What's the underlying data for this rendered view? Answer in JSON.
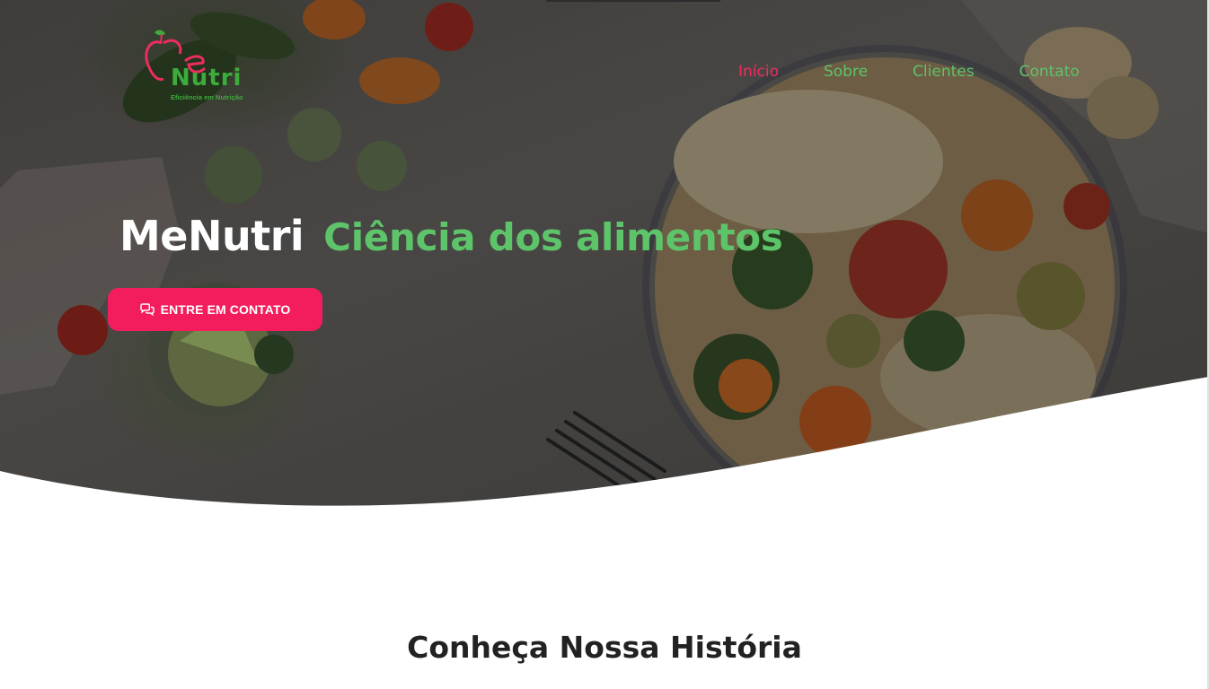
{
  "header": {
    "logo": {
      "brand": "Nutri",
      "tagline": "Eficiência em Nutrição",
      "colors": {
        "primary": "#ef2c60",
        "secondary": "#3dab3d"
      }
    },
    "nav": [
      {
        "label": "Início",
        "active": true
      },
      {
        "label": "Sobre",
        "active": false
      },
      {
        "label": "Clientes",
        "active": false
      },
      {
        "label": "Contato",
        "active": false
      }
    ]
  },
  "hero": {
    "title_brand": "MeNutri",
    "title_tagline": "Ciência dos alimentos",
    "cta": {
      "label": "ENTRE EM CONTATO",
      "icon": "chat-bubbles-icon"
    }
  },
  "section": {
    "title": "Conheça Nossa História"
  },
  "colors": {
    "accent": "#f31d5e",
    "nav_active": "#ef2c60",
    "green": "#5ec46a",
    "text_dark": "#222222"
  }
}
